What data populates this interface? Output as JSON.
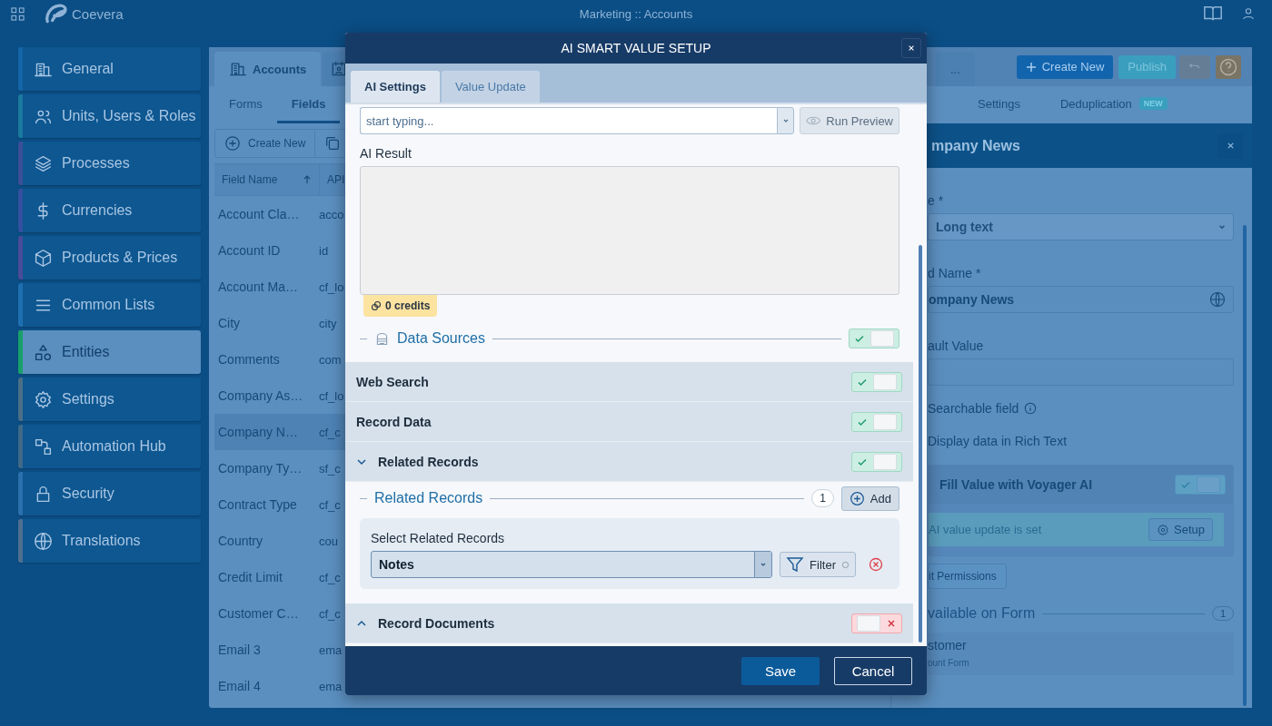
{
  "top_bar": {
    "app_name": "Coevera",
    "title": "Marketing :: Accounts"
  },
  "sidebar": {
    "items": [
      {
        "label": "General",
        "selected": false,
        "color": "#1565a8"
      },
      {
        "label": "Units, Users & Roles",
        "selected": false,
        "color": "#1a7aa0"
      },
      {
        "label": "Processes",
        "selected": false,
        "color": "#3d4f9a"
      },
      {
        "label": "Currencies",
        "selected": false,
        "color": "#34509f"
      },
      {
        "label": "Products & Prices",
        "selected": false,
        "color": "#4a4b9a"
      },
      {
        "label": "Common Lists",
        "selected": false,
        "color": "#1e6fb0"
      },
      {
        "label": "Entities",
        "selected": true,
        "color": "#1aa06a"
      },
      {
        "label": "Settings",
        "selected": false,
        "color": "#4a6f86"
      },
      {
        "label": "Automation Hub",
        "selected": false,
        "color": "#3f6a88"
      },
      {
        "label": "Security",
        "selected": false,
        "color": "#2a6fae"
      },
      {
        "label": "Translations",
        "selected": false,
        "color": "#4f6f90"
      }
    ]
  },
  "entity_tabs": [
    {
      "label": "Accounts",
      "selected": true
    },
    {
      "selected": false
    },
    {
      "label": "...",
      "selected": false
    }
  ],
  "actions": {
    "create": "Create New",
    "publish": "Publish"
  },
  "sub_tabs": [
    {
      "label": "Forms",
      "selected": false
    },
    {
      "label": "Fields",
      "selected": true
    },
    {
      "label": "Settings",
      "selected": false
    },
    {
      "label": "Deduplication",
      "selected": false,
      "badge": "NEW"
    }
  ],
  "toolbar": {
    "create": "Create New"
  },
  "table": {
    "columns": [
      {
        "label": "Field Name",
        "sorted": true
      },
      {
        "label": "API",
        "sorted": false
      }
    ],
    "rows": [
      {
        "name": "Account Cla…",
        "api": "acco",
        "selected": false
      },
      {
        "name": "Account ID",
        "api": "id",
        "selected": false
      },
      {
        "name": "Account Ma…",
        "api": "cf_lo",
        "selected": false
      },
      {
        "name": "City",
        "api": "city",
        "selected": false
      },
      {
        "name": "Comments",
        "api": "com",
        "selected": false
      },
      {
        "name": "Company As…",
        "api": "cf_lo",
        "selected": false
      },
      {
        "name": "Company N…",
        "api": "cf_c",
        "selected": true
      },
      {
        "name": "Company Ty…",
        "api": "sf_c",
        "selected": false
      },
      {
        "name": "Contract Type",
        "api": "cf_c",
        "selected": false
      },
      {
        "name": "Country",
        "api": "cou",
        "selected": false
      },
      {
        "name": "Credit Limit",
        "api": "cf_c",
        "selected": false
      },
      {
        "name": "Customer C…",
        "api": "cf_c",
        "selected": false
      },
      {
        "name": "Email 3",
        "api": "ema",
        "selected": false
      },
      {
        "name": "Email 4",
        "api": "ema",
        "selected": false
      }
    ]
  },
  "drawer": {
    "title": "mpany News",
    "type_label": "e *",
    "type_value": "Long text",
    "name_label": "d Name *",
    "name_value": "ompany News",
    "default_label": "ault Value",
    "options": [
      {
        "label": "Searchable field",
        "kind": "info"
      },
      {
        "label": "Display data in Rich Text",
        "kind": "plain"
      }
    ],
    "ai_card": {
      "title": "Fill Value with Voyager AI",
      "on": true,
      "status": "AI value update is set",
      "setup": "Setup"
    },
    "permissions": "it Permissions",
    "section": {
      "title": "vailable on Form",
      "count": "1"
    },
    "form_item": {
      "name": "stomer",
      "sub": "ount Form"
    }
  },
  "modal": {
    "title": "AI SMART VALUE SETUP",
    "tabs": [
      {
        "label": "AI Settings",
        "selected": true
      },
      {
        "label": "Value Update",
        "selected": false
      }
    ],
    "prompt_select": {
      "placeholder": "start typing..."
    },
    "run_preview": "Run Preview",
    "result_label": "AI Result",
    "credits": "0 credits",
    "data_sources": {
      "title": "Data Sources",
      "on": true,
      "rows": [
        {
          "label": "Web Search",
          "kind": "plain",
          "on": true
        },
        {
          "label": "Record Data",
          "kind": "plain",
          "on": true
        },
        {
          "label": "Related Records",
          "kind": "group",
          "on": true,
          "expanded": true,
          "section": {
            "title": "Related Records",
            "count": "1",
            "add": "Add",
            "items": [
              {
                "label": "Select Related Records",
                "value": "Notes",
                "filter": "Filter"
              }
            ]
          }
        },
        {
          "label": "Record Documents",
          "kind": "group",
          "on": false,
          "expanded": false
        }
      ]
    },
    "save": "Save",
    "cancel": "Cancel"
  }
}
